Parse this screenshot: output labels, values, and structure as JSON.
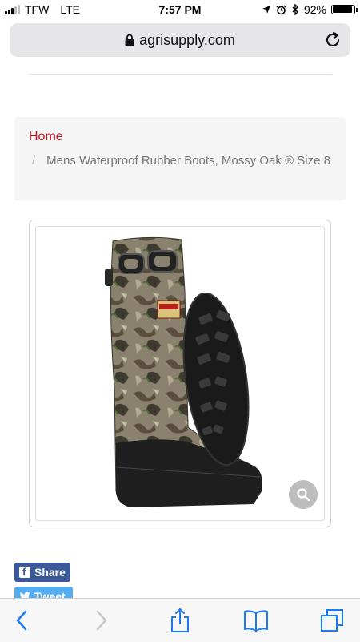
{
  "status_bar": {
    "carrier": "TFW",
    "network": "LTE",
    "time": "7:57 PM",
    "battery_percent": "92%",
    "battery_level": 0.92
  },
  "browser": {
    "url": "agrisupply.com"
  },
  "breadcrumb": {
    "home": "Home",
    "separator": "/",
    "current": "Mens Waterproof Rubber Boots, Mossy Oak ® Size 8"
  },
  "share": {
    "facebook_label": "Share",
    "twitter_label": "Tweet"
  },
  "colors": {
    "accent_red": "#c0131f",
    "facebook_blue": "#3b5998",
    "twitter_blue": "#55acee",
    "ios_blue": "#1a7cf5"
  },
  "icons": {
    "lock": "lock-icon",
    "reload": "reload-icon",
    "zoom": "magnifier-icon",
    "back": "chevron-left-icon",
    "forward": "chevron-right-icon",
    "share": "share-icon",
    "bookmarks": "book-icon",
    "tabs": "tabs-icon"
  }
}
